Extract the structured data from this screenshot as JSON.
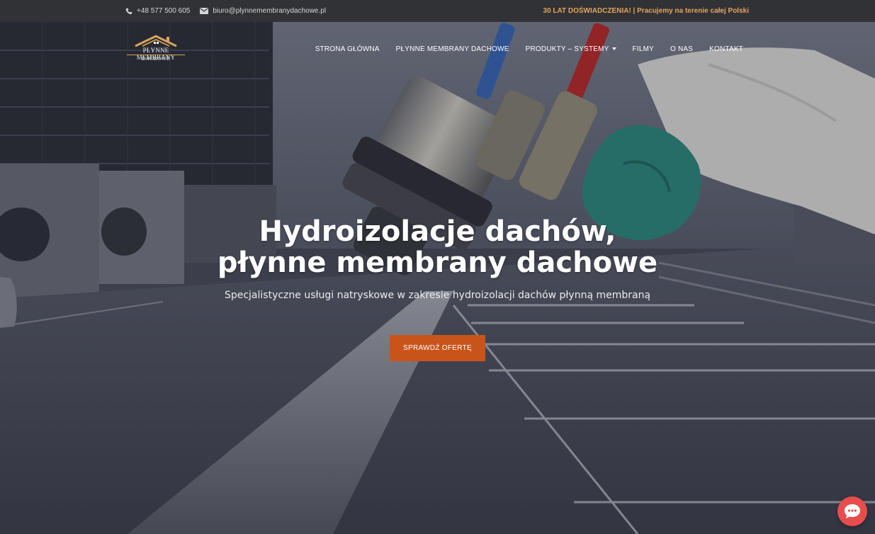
{
  "topbar": {
    "phone": "+48 577 500 605",
    "email": "biuro@plynnemembranydachowe.pl",
    "tagline": "30 LAT DOŚWIADCZENIA! | Pracujemy na terenie całej Polski",
    "icons": [
      "phone-icon",
      "envelope-icon"
    ]
  },
  "logo": {
    "line1": "PŁYNNE MEMBRANY",
    "line2": "DACHOWE"
  },
  "nav": {
    "items": [
      {
        "label": "STRONA GŁÓWNA"
      },
      {
        "label": "PŁYNNE MEMBRANY DACHOWE"
      },
      {
        "label": "PRODUKTY – SYSTEMY",
        "dropdown": true
      },
      {
        "label": "FILMY"
      },
      {
        "label": "O NAS"
      },
      {
        "label": "KONTAKT"
      }
    ]
  },
  "hero": {
    "headline_line1": "Hydroizolacje dachów,",
    "headline_line2": "płynne membrany dachowe",
    "subtitle": "Specjalistyczne usługi natryskowe w zakresie hydroizolacji dachów płynną membraną",
    "cta_label": "SPRAWDŹ OFERTĘ"
  },
  "chat": {
    "icon": "chat-bubble-icon"
  },
  "colors": {
    "accent": "#e3a45d",
    "cta": "#c9541a",
    "chat": "#e84d4d",
    "topbar": "#313236"
  }
}
